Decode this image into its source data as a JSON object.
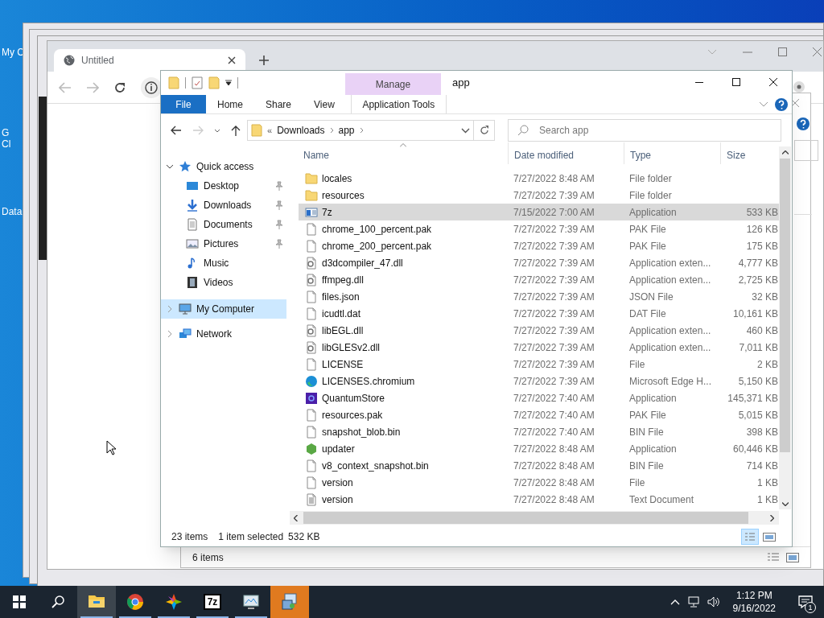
{
  "desktop_icons": [
    {
      "lines": [
        "My C"
      ]
    },
    {
      "lines": [
        "G",
        "Cl"
      ]
    },
    {
      "lines": [
        "Data"
      ]
    }
  ],
  "browser": {
    "tab_title": "Untitled"
  },
  "back_window": {
    "status": "6 items"
  },
  "explorer": {
    "title": "app",
    "context_group": "Manage",
    "ribbon_tabs": [
      {
        "label": "File",
        "kind": "file",
        "selected": false
      },
      {
        "label": "Home",
        "kind": "tab",
        "selected": false
      },
      {
        "label": "Share",
        "kind": "tab",
        "selected": false
      },
      {
        "label": "View",
        "kind": "tab",
        "selected": false
      },
      {
        "label": "Application Tools",
        "kind": "context",
        "selected": false
      }
    ],
    "address": {
      "overflow": "«",
      "breadcrumbs": [
        "Downloads",
        "app"
      ]
    },
    "search": {
      "placeholder": "Search app"
    },
    "nav": [
      {
        "label": "Quick access",
        "kind": "star",
        "expanded": true,
        "selected": false,
        "children": [
          {
            "label": "Desktop",
            "kind": "desktop",
            "pinned": true,
            "selected": false
          },
          {
            "label": "Downloads",
            "kind": "download",
            "pinned": true,
            "selected": false
          },
          {
            "label": "Documents",
            "kind": "document",
            "pinned": true,
            "selected": false
          },
          {
            "label": "Pictures",
            "kind": "pictures",
            "pinned": true,
            "selected": false
          },
          {
            "label": "Music",
            "kind": "music",
            "pinned": false,
            "selected": false
          },
          {
            "label": "Videos",
            "kind": "videos",
            "pinned": false,
            "selected": false
          }
        ]
      },
      {
        "label": "My Computer",
        "kind": "computer",
        "expanded": false,
        "selected": true
      },
      {
        "label": "Network",
        "kind": "network",
        "expanded": false,
        "selected": false
      }
    ],
    "columns": [
      {
        "label": "Name",
        "sorted": true
      },
      {
        "label": "Date modified",
        "sorted": false
      },
      {
        "label": "Type",
        "sorted": false
      },
      {
        "label": "Size",
        "sorted": false
      }
    ],
    "files": [
      {
        "name": "locales",
        "date": "7/27/2022 8:48 AM",
        "type": "File folder",
        "kind": "folder",
        "selected": false
      },
      {
        "name": "resources",
        "date": "7/27/2022 7:39 AM",
        "type": "File folder",
        "kind": "folder",
        "selected": false
      },
      {
        "name": "7z",
        "date": "7/15/2022 7:00 AM",
        "type": "Application",
        "size": "533 KB",
        "kind": "window",
        "selected": true
      },
      {
        "name": "chrome_100_percent.pak",
        "date": "7/27/2022 7:39 AM",
        "type": "PAK File",
        "size": "126 KB",
        "kind": "file",
        "selected": false
      },
      {
        "name": "chrome_200_percent.pak",
        "date": "7/27/2022 7:39 AM",
        "type": "PAK File",
        "size": "175 KB",
        "kind": "file",
        "selected": false
      },
      {
        "name": "d3dcompiler_47.dll",
        "date": "7/27/2022 7:39 AM",
        "type": "Application exten...",
        "size": "4,777 KB",
        "kind": "dll",
        "selected": false
      },
      {
        "name": "ffmpeg.dll",
        "date": "7/27/2022 7:39 AM",
        "type": "Application exten...",
        "size": "2,725 KB",
        "kind": "dll",
        "selected": false
      },
      {
        "name": "files.json",
        "date": "7/27/2022 7:39 AM",
        "type": "JSON File",
        "size": "32 KB",
        "kind": "file",
        "selected": false
      },
      {
        "name": "icudtl.dat",
        "date": "7/27/2022 7:39 AM",
        "type": "DAT File",
        "size": "10,161 KB",
        "kind": "file",
        "selected": false
      },
      {
        "name": "libEGL.dll",
        "date": "7/27/2022 7:39 AM",
        "type": "Application exten...",
        "size": "460 KB",
        "kind": "dll",
        "selected": false
      },
      {
        "name": "libGLESv2.dll",
        "date": "7/27/2022 7:39 AM",
        "type": "Application exten...",
        "size": "7,011 KB",
        "kind": "dll",
        "selected": false
      },
      {
        "name": "LICENSE",
        "date": "7/27/2022 7:39 AM",
        "type": "File",
        "size": "2 KB",
        "kind": "file",
        "selected": false
      },
      {
        "name": "LICENSES.chromium",
        "date": "7/27/2022 7:39 AM",
        "type": "Microsoft Edge H...",
        "size": "5,150 KB",
        "kind": "swirl",
        "selected": false
      },
      {
        "name": "QuantumStore",
        "date": "7/27/2022 7:40 AM",
        "type": "Application",
        "size": "145,371 KB",
        "kind": "square",
        "selected": false
      },
      {
        "name": "resources.pak",
        "date": "7/27/2022 7:40 AM",
        "type": "PAK File",
        "size": "5,015 KB",
        "kind": "file",
        "selected": false
      },
      {
        "name": "snapshot_blob.bin",
        "date": "7/27/2022 7:40 AM",
        "type": "BIN File",
        "size": "398 KB",
        "kind": "file",
        "selected": false
      },
      {
        "name": "updater",
        "date": "7/27/2022 8:48 AM",
        "type": "Application",
        "size": "60,446 KB",
        "kind": "hexagon",
        "selected": false
      },
      {
        "name": "v8_context_snapshot.bin",
        "date": "7/27/2022 8:48 AM",
        "type": "BIN File",
        "size": "714 KB",
        "kind": "file",
        "selected": false
      },
      {
        "name": "version",
        "date": "7/27/2022 8:48 AM",
        "type": "File",
        "size": "1 KB",
        "kind": "file",
        "selected": false
      },
      {
        "name": "version",
        "date": "7/27/2022 8:48 AM",
        "type": "Text Document",
        "size": "1 KB",
        "kind": "text",
        "selected": false
      }
    ],
    "status": {
      "items": "23 items",
      "selection": "1 item selected",
      "selection_size": "532 KB"
    },
    "views": [
      {
        "kind": "details",
        "selected": true
      },
      {
        "kind": "thumbnails",
        "selected": false
      }
    ]
  },
  "taskbar": {
    "apps": [
      {
        "kind": "folder",
        "running": true,
        "flashing": false,
        "hovered": true
      },
      {
        "kind": "browser",
        "running": true,
        "flashing": false,
        "hovered": false
      },
      {
        "kind": "pinwheel",
        "running": true,
        "flashing": false,
        "hovered": false
      },
      {
        "kind": "label",
        "label": "7z",
        "running": true,
        "flashing": false,
        "hovered": false
      },
      {
        "kind": "monitor",
        "running": true,
        "flashing": false,
        "hovered": false
      },
      {
        "kind": "installer",
        "running": false,
        "flashing": true,
        "hovered": false
      }
    ],
    "time": "1:12 PM",
    "date": "9/16/2022",
    "notifications": "1"
  }
}
